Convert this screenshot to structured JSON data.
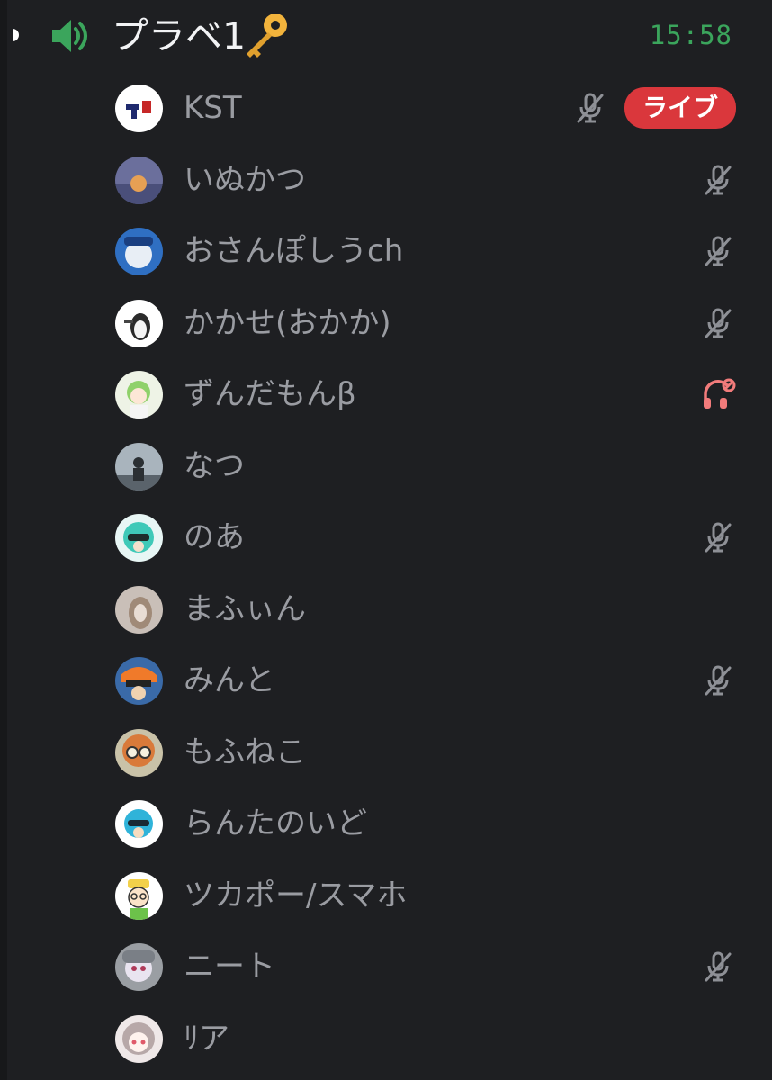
{
  "channel": {
    "name": "プラベ1",
    "emoji": "key",
    "elapsed": "15:58",
    "icon": "speaker-icon"
  },
  "colors": {
    "background": "#1e1f22",
    "name_text": "#9a9ca2",
    "timer": "#3ba55c",
    "live": "#da373c",
    "muted_icon": "#8e9096",
    "deafened_icon": "#f27b7b"
  },
  "members": [
    {
      "name": "KST",
      "muted": true,
      "deafened": false,
      "live": "ライブ",
      "avatar": "avatar-kst"
    },
    {
      "name": "いぬかつ",
      "muted": true,
      "deafened": false,
      "avatar": "avatar-inukatsu"
    },
    {
      "name": "おさんぽしうch",
      "muted": true,
      "deafened": false,
      "avatar": "avatar-osanpo"
    },
    {
      "name": "かかせ(おかか)",
      "muted": true,
      "deafened": false,
      "avatar": "avatar-kakase"
    },
    {
      "name": "ずんだもんβ",
      "muted": false,
      "deafened": true,
      "avatar": "avatar-zundamon"
    },
    {
      "name": "なつ",
      "muted": false,
      "deafened": false,
      "avatar": "avatar-natsu"
    },
    {
      "name": "のあ",
      "muted": true,
      "deafened": false,
      "avatar": "avatar-noa"
    },
    {
      "name": "まふぃん",
      "muted": false,
      "deafened": false,
      "avatar": "avatar-mafin"
    },
    {
      "name": "みんと",
      "muted": true,
      "deafened": false,
      "avatar": "avatar-minto"
    },
    {
      "name": "もふねこ",
      "muted": false,
      "deafened": false,
      "avatar": "avatar-mofuneko"
    },
    {
      "name": "らんたのいど",
      "muted": false,
      "deafened": false,
      "avatar": "avatar-rantanoido"
    },
    {
      "name": "ツカポー/スマホ",
      "muted": false,
      "deafened": false,
      "avatar": "avatar-tsukapo"
    },
    {
      "name": "ニート",
      "muted": true,
      "deafened": false,
      "avatar": "avatar-neet"
    },
    {
      "name": "ﾘア",
      "muted": false,
      "deafened": false,
      "avatar": "avatar-ria"
    }
  ]
}
